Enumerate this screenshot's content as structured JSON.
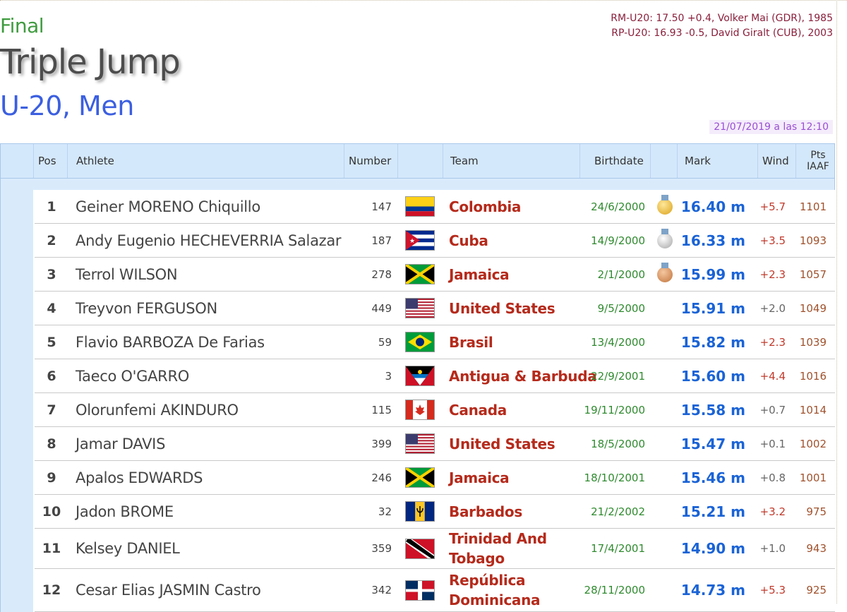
{
  "header": {
    "phase": "Final",
    "event": "Triple Jump",
    "category": "U-20, Men",
    "records": [
      "RM-U20: 17.50 +0.4, Volker Mai (GDR), 1985",
      "RP-U20: 16.93 -0.5, David Giralt (CUB), 2003"
    ],
    "datetime": "21/07/2019 a las 12:10"
  },
  "columns": {
    "pos": "Pos",
    "athlete": "Athlete",
    "number": "Number",
    "team": "Team",
    "birthdate": "Birthdate",
    "mark": "Mark",
    "wind": "Wind",
    "pts": "Pts\nIAAF"
  },
  "colors": {
    "wind_positive": "#c0392b",
    "wind_legal": "#666666"
  },
  "results": [
    {
      "pos": "1",
      "athlete": "Geiner MORENO Chiquillo",
      "number": "147",
      "flag": "colombia-flag",
      "team": "Colombia",
      "birthdate": "24/6/2000",
      "medal": "gold",
      "mark": "16.40 m",
      "wind": "+5.7",
      "pts": "1101"
    },
    {
      "pos": "2",
      "athlete": "Andy Eugenio HECHEVERRIA Salazar",
      "number": "187",
      "flag": "cuba-flag",
      "team": "Cuba",
      "birthdate": "14/9/2000",
      "medal": "silver",
      "mark": "16.33 m",
      "wind": "+3.5",
      "pts": "1093"
    },
    {
      "pos": "3",
      "athlete": "Terrol WILSON",
      "number": "278",
      "flag": "jamaica-flag",
      "team": "Jamaica",
      "birthdate": "2/1/2000",
      "medal": "bronze",
      "mark": "15.99 m",
      "wind": "+2.3",
      "pts": "1057"
    },
    {
      "pos": "4",
      "athlete": "Treyvon FERGUSON",
      "number": "449",
      "flag": "usa-flag",
      "team": "United States",
      "birthdate": "9/5/2000",
      "medal": "",
      "mark": "15.91 m",
      "wind": "+2.0",
      "pts": "1049"
    },
    {
      "pos": "5",
      "athlete": "Flavio BARBOZA De Farias",
      "number": "59",
      "flag": "brazil-flag",
      "team": "Brasil",
      "birthdate": "13/4/2000",
      "medal": "",
      "mark": "15.82 m",
      "wind": "+2.3",
      "pts": "1039"
    },
    {
      "pos": "6",
      "athlete": "Taeco O'GARRO",
      "number": "3",
      "flag": "antigua-flag",
      "team": "Antigua & Barbuda",
      "birthdate": "22/9/2001",
      "medal": "",
      "mark": "15.60 m",
      "wind": "+4.4",
      "pts": "1016"
    },
    {
      "pos": "7",
      "athlete": "Olorunfemi AKINDURO",
      "number": "115",
      "flag": "canada-flag",
      "team": "Canada",
      "birthdate": "19/11/2000",
      "medal": "",
      "mark": "15.58 m",
      "wind": "+0.7",
      "pts": "1014"
    },
    {
      "pos": "8",
      "athlete": "Jamar DAVIS",
      "number": "399",
      "flag": "usa-flag",
      "team": "United States",
      "birthdate": "18/5/2000",
      "medal": "",
      "mark": "15.47 m",
      "wind": "+0.1",
      "pts": "1002"
    },
    {
      "pos": "9",
      "athlete": "Apalos EDWARDS",
      "number": "246",
      "flag": "jamaica-flag",
      "team": "Jamaica",
      "birthdate": "18/10/2001",
      "medal": "",
      "mark": "15.46 m",
      "wind": "+0.8",
      "pts": "1001"
    },
    {
      "pos": "10",
      "athlete": "Jadon BROME",
      "number": "32",
      "flag": "barbados-flag",
      "team": "Barbados",
      "birthdate": "21/2/2002",
      "medal": "",
      "mark": "15.21 m",
      "wind": "+3.2",
      "pts": "975"
    },
    {
      "pos": "11",
      "athlete": "Kelsey DANIEL",
      "number": "359",
      "flag": "trinidad-flag",
      "team": "Trinidad And Tobago",
      "birthdate": "17/4/2001",
      "medal": "",
      "mark": "14.90 m",
      "wind": "+1.0",
      "pts": "943"
    },
    {
      "pos": "12",
      "athlete": "Cesar Elias JASMIN Castro",
      "number": "342",
      "flag": "dominican-flag",
      "team": "República Dominicana",
      "birthdate": "28/11/2000",
      "medal": "",
      "mark": "14.73 m",
      "wind": "+5.3",
      "pts": "925"
    }
  ]
}
